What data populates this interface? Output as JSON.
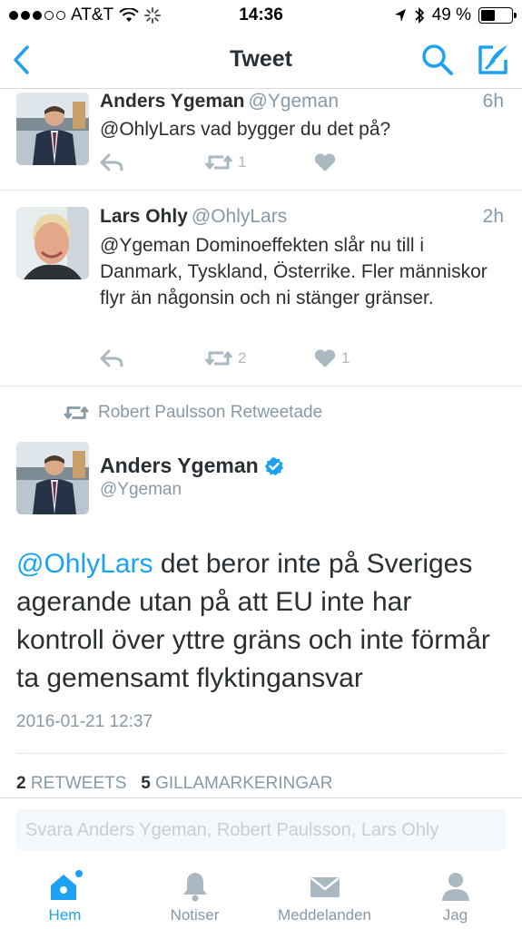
{
  "status_bar": {
    "carrier": "AT&T",
    "time": "14:36",
    "battery": "49 %",
    "battery_level": 0.49
  },
  "nav": {
    "title": "Tweet"
  },
  "replies": [
    {
      "name": "Anders Ygeman",
      "handle": "@Ygeman",
      "time": "6h",
      "text": "@OhlyLars vad bygger du det på?",
      "retweets": "1",
      "likes": ""
    },
    {
      "name": "Lars Ohly",
      "handle": "@OhlyLars",
      "time": "2h",
      "text": "@Ygeman Dominoeffekten slår nu till i Danmark, Tyskland, Österrike. Fler människor flyr än någonsin och ni stänger gränser.",
      "retweets": "2",
      "likes": "1"
    }
  ],
  "retweeted_by": "Robert Paulsson Retweetade",
  "main_tweet": {
    "name": "Anders Ygeman",
    "handle": "@Ygeman",
    "mention": "@OhlyLars",
    "text": " det beror inte på Sveriges agerande utan på att EU inte har kontroll över yttre gräns och inte förmår ta gemensamt flyktingansvar",
    "date": "2016-01-21 12:37",
    "retweet_count": "2",
    "retweet_label": "RETWEETS",
    "like_count": "5",
    "like_label": "GILLAMARKERINGAR"
  },
  "reply_bar": {
    "placeholder": "Svara Anders Ygeman, Robert Paulsson, Lars Ohly"
  },
  "tabs": [
    {
      "label": "Hem",
      "icon": "home-icon"
    },
    {
      "label": "Notiser",
      "icon": "bell-icon"
    },
    {
      "label": "Meddelanden",
      "icon": "envelope-icon"
    },
    {
      "label": "Jag",
      "icon": "person-icon"
    }
  ],
  "colors": {
    "accent": "#1da1f2",
    "muted": "#8899a6",
    "text": "#292f33"
  }
}
